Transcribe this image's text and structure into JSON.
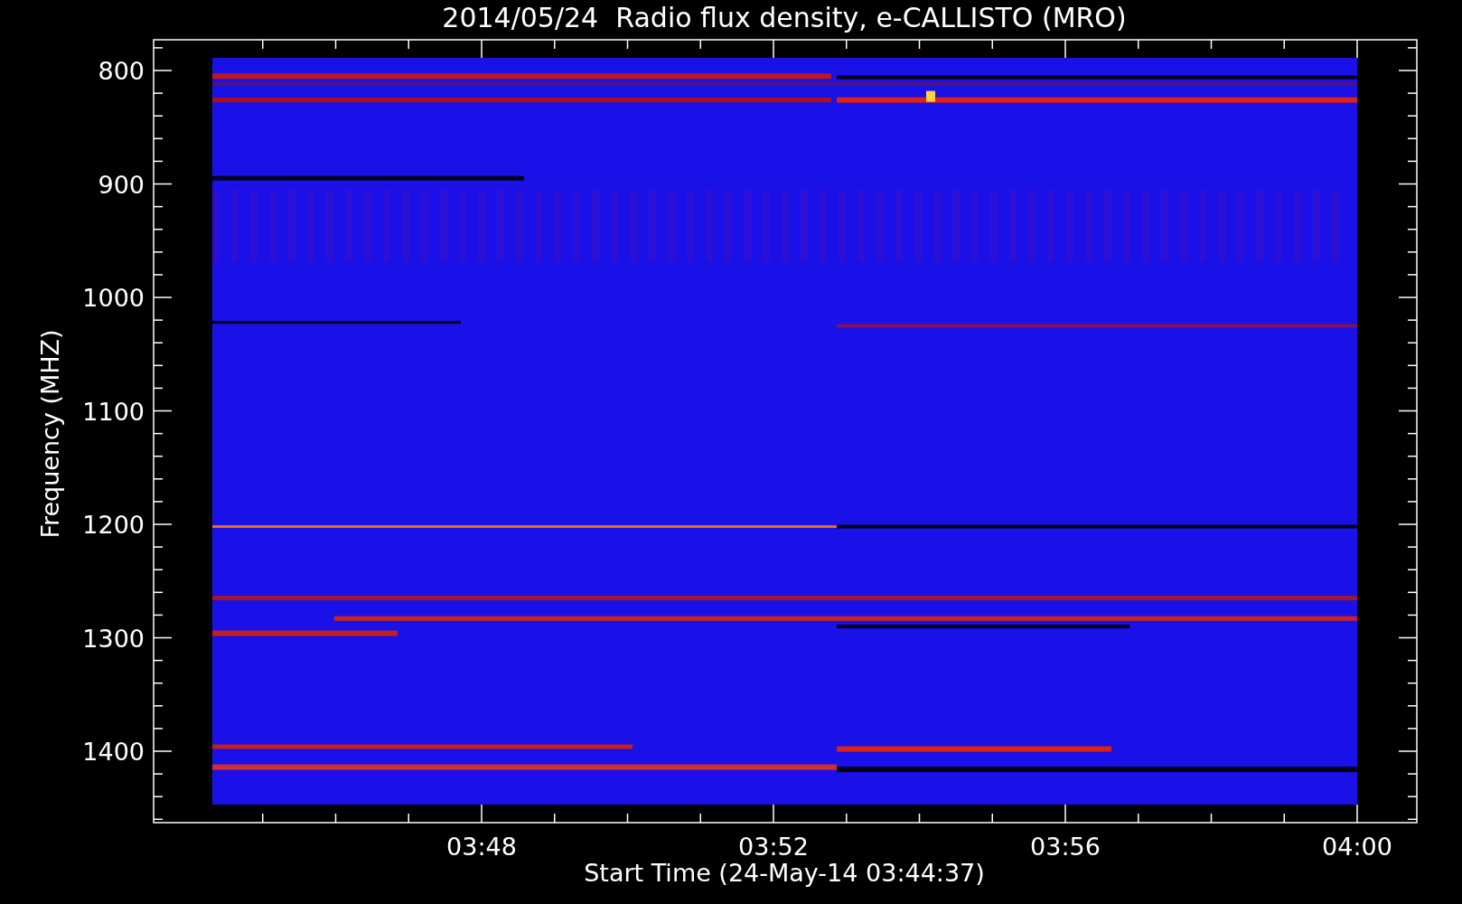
{
  "title": "2014/05/24  Radio flux density, e-CALLISTO (MRO)",
  "y_axis": {
    "label": "Frequency (MHZ)",
    "ticks": [
      "800",
      "900",
      "1000",
      "1100",
      "1200",
      "1300",
      "1400"
    ]
  },
  "x_axis": {
    "label": "Start Time (24-May-14 03:44:37)",
    "ticks": [
      "03:48",
      "03:52",
      "03:56",
      "04:00"
    ]
  }
}
